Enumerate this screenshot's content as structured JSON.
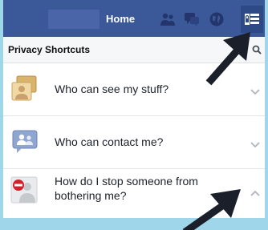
{
  "topbar": {
    "home_label": "Home",
    "icons": [
      "friends-icon",
      "messages-icon",
      "globe-icon",
      "privacy-lock-icon"
    ],
    "brand_color": "#3b5998"
  },
  "privacy_shortcuts": {
    "title": "Privacy Shortcuts",
    "search_icon": "search-icon",
    "items": [
      {
        "label": "Who can see my stuff?",
        "icon": "photos-lock-icon",
        "chevron": "chevron-down"
      },
      {
        "label": "Who can contact me?",
        "icon": "contact-people-icon",
        "chevron": "chevron-down"
      },
      {
        "label": "How do I stop someone from bothering me?",
        "icon": "block-person-icon",
        "chevron": "chevron-up"
      }
    ]
  },
  "annotations": {
    "arrow_color": "#1a1f2a"
  }
}
